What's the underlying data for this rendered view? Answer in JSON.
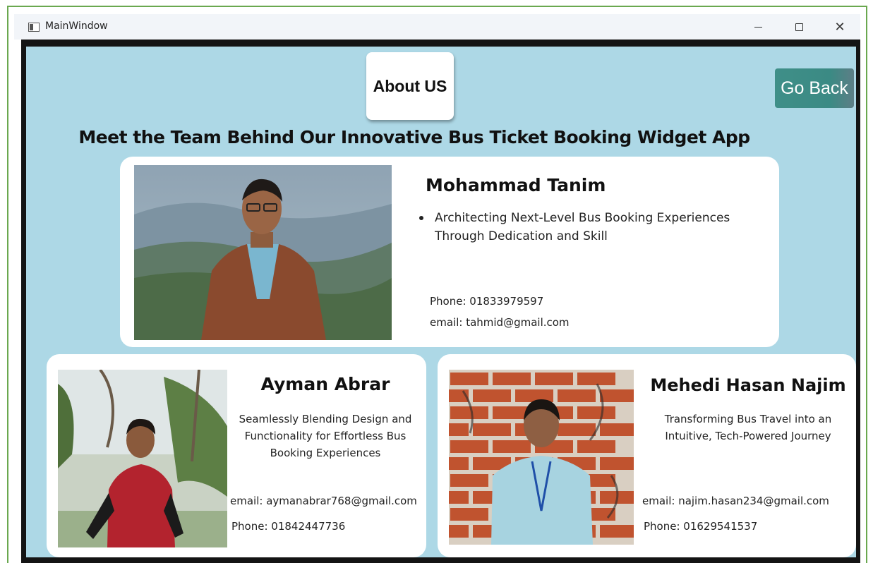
{
  "window": {
    "title": "MainWindow",
    "minimize_glyph": "",
    "close_glyph": "✕"
  },
  "header": {
    "about_title": "About US",
    "go_back_label": "Go Back",
    "headline": "Meet the Team Behind Our Innovative Bus Ticket Booking Widget App"
  },
  "team": [
    {
      "name": "Mohammad Tanim",
      "tagline": "Architecting Next-Level Bus Booking Experiences Through Dedication and Skill",
      "phone": "Phone: 01833979597",
      "email": "email: tahmid@gmail.com",
      "photo_icon": "person-photo"
    },
    {
      "name": "Ayman Abrar",
      "tagline": "Seamlessly Blending Design and Functionality for Effortless Bus Booking Experiences",
      "email": "email: aymanabrar768@gmail.com",
      "phone": "Phone: 01842447736",
      "photo_icon": "person-photo"
    },
    {
      "name": "Mehedi Hasan Najim",
      "tagline": "Transforming Bus Travel into an Intuitive, Tech-Powered Journey",
      "email": "email: najim.hasan234@gmail.com",
      "phone": "Phone: 01629541537",
      "photo_icon": "person-photo"
    }
  ],
  "colors": {
    "background": "#add8e6",
    "go_back": "#3b8a84",
    "card": "#ffffff",
    "frame": "#6aa84f"
  }
}
